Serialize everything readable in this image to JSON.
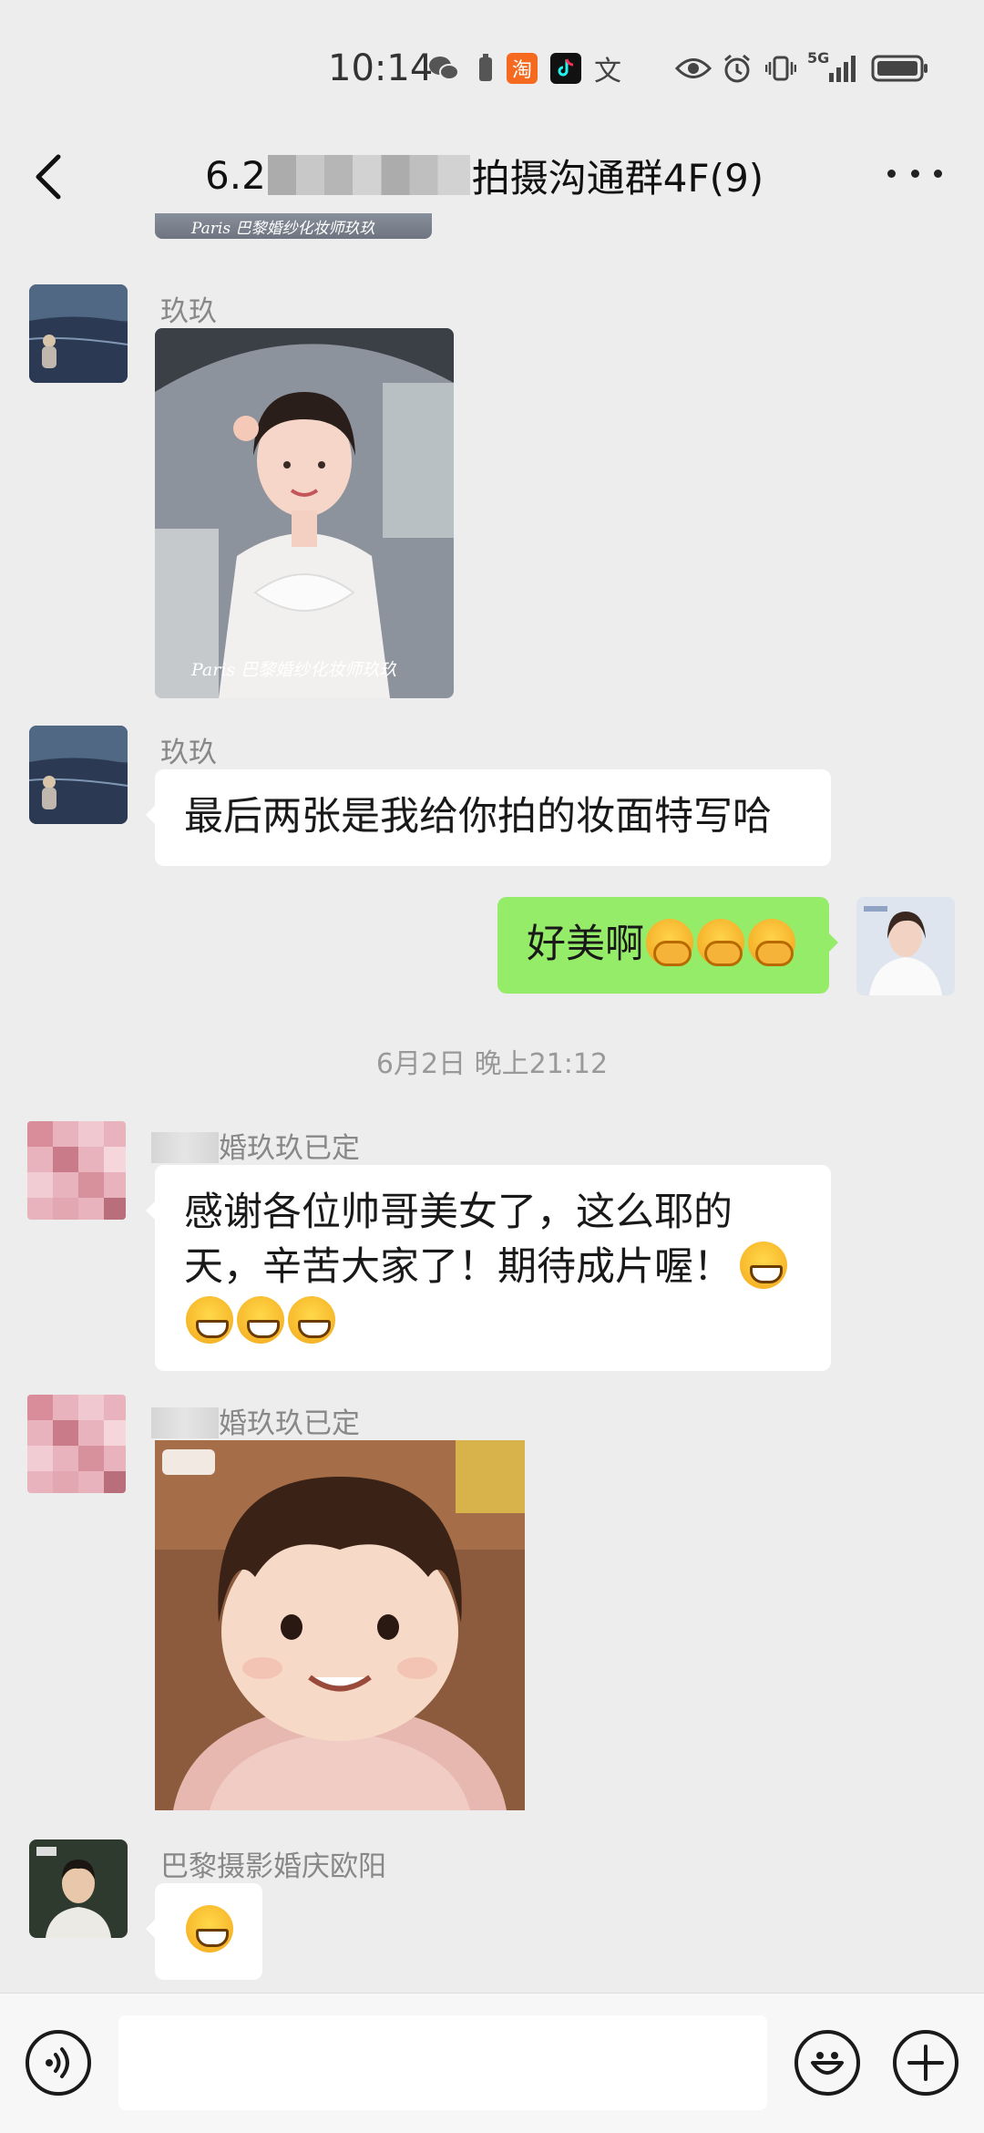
{
  "status_bar": {
    "time": "10:14",
    "icons": [
      "wechat-icon",
      "battery-saver-icon",
      "taobao-icon",
      "tiktok-icon",
      "translate-icon",
      "eye-icon",
      "alarm-icon",
      "vibrate-icon",
      "5g-signal-icon",
      "battery-icon"
    ],
    "taobao_glyph": "淘",
    "translate_glyph": "文",
    "network_label": "5G"
  },
  "header": {
    "title_prefix": "6.2",
    "title_suffix": "拍摄沟通群4F(9)"
  },
  "messages": {
    "photo_watermark_top": "Paris 巴黎婚纱化妆师玖玖",
    "m1_sender": "玖玖",
    "m1_photo_watermark": "Paris 巴黎婚纱化妆师玖玖",
    "m2_sender": "玖玖",
    "m2_text": "最后两张是我给你拍的妆面特写哈",
    "m3_text": "好美啊",
    "timestamp": "6月2日 晚上21:12",
    "m4_sender": "婚玖玖已定",
    "m4_text_line1": "感谢各位帅哥美女了，这么耶的",
    "m4_text_line2": "天，辛苦大家了！期待成片喔！",
    "m5_sender": "婚玖玖已定",
    "m6_sender": "巴黎摄影婚庆欧阳"
  },
  "colors": {
    "background": "#ededed",
    "my_bubble": "#95ec69",
    "other_bubble": "#ffffff"
  }
}
